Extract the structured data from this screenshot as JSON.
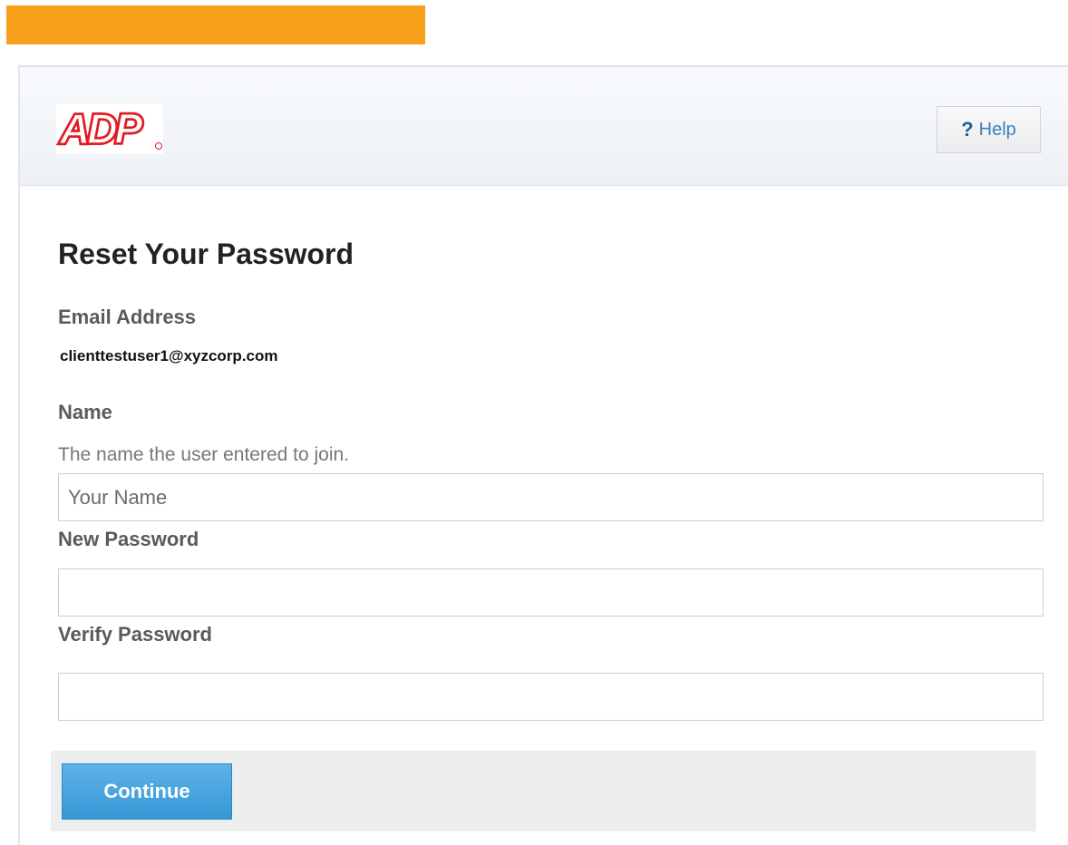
{
  "brand": {
    "banner_color": "#f7a11b",
    "logo_text": "ADP",
    "logo_color": "#e31b23"
  },
  "header": {
    "help_icon": "question-mark-icon",
    "help_icon_glyph": "?",
    "help_label": "Help"
  },
  "form": {
    "title": "Reset Your Password",
    "email_label": "Email Address",
    "email_value": "clienttestuser1@xyzcorp.com",
    "name_label": "Name",
    "name_hint": "The name the user entered to join.",
    "name_placeholder": "Your Name",
    "name_value": "",
    "new_password_label": "New Password",
    "new_password_value": "",
    "verify_password_label": "Verify Password",
    "verify_password_value": ""
  },
  "actions": {
    "continue_label": "Continue",
    "continue_color": "#3797d6"
  }
}
